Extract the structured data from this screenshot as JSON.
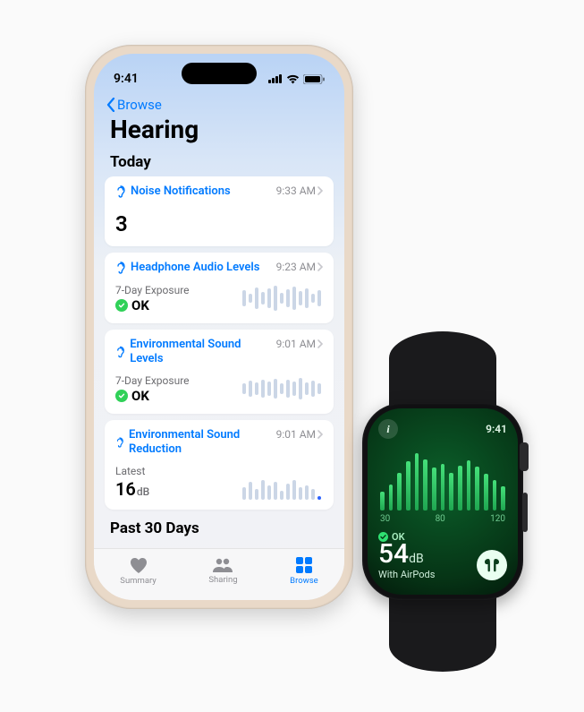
{
  "phone": {
    "status": {
      "time": "9:41"
    },
    "nav": {
      "back_label": "Browse"
    },
    "title": "Hearing",
    "section_today": "Today",
    "section_past": "Past 30 Days",
    "cards": {
      "noise_notif": {
        "title": "Noise Notifications",
        "time": "9:33 AM",
        "value": "3"
      },
      "headphone_levels": {
        "title": "Headphone Audio Levels",
        "time": "9:23 AM",
        "sub": "7-Day Exposure",
        "status": "OK"
      },
      "env_levels": {
        "title": "Environmental Sound Levels",
        "time": "9:01 AM",
        "sub": "7-Day Exposure",
        "status": "OK"
      },
      "env_reduction": {
        "title": "Environmental Sound Reduction",
        "time": "9:01 AM",
        "sub": "Latest",
        "value": "16",
        "unit": "dB"
      }
    },
    "tabs": {
      "summary": "Summary",
      "sharing": "Sharing",
      "browse": "Browse"
    }
  },
  "watch": {
    "time": "9:41",
    "scale": {
      "a": "30",
      "b": "80",
      "c": "120"
    },
    "status": "OK",
    "value": "54",
    "unit": "dB",
    "sub": "With AirPods"
  }
}
